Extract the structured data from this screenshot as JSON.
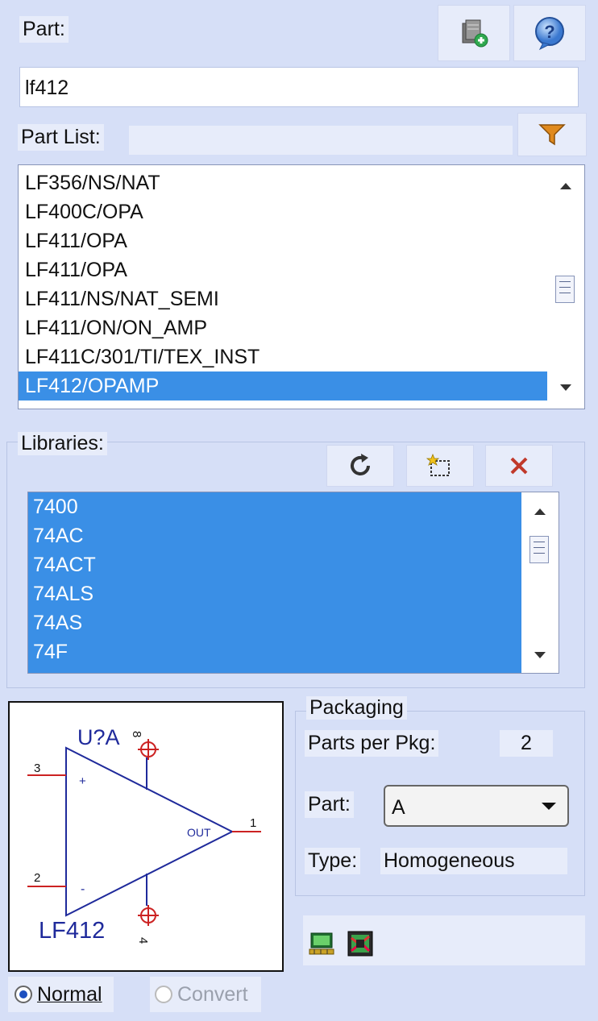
{
  "part": {
    "label": "Part:",
    "value": "lf412"
  },
  "toolbar": {
    "add_part_icon": "add-part-icon",
    "help_icon": "help-icon",
    "filter_icon": "filter-icon"
  },
  "part_list": {
    "label": "Part List:",
    "items": [
      "LF356/NS/NAT",
      "LF400C/OPA",
      "LF411/OPA",
      "LF411/OPA",
      "LF411/NS/NAT_SEMI",
      "LF411/ON/ON_AMP",
      "LF411C/301/TI/TEX_INST",
      "LF412/OPAMP"
    ],
    "selected": "LF412/OPAMP"
  },
  "libraries": {
    "label": "Libraries:",
    "items": [
      "7400",
      "74AC",
      "74ACT",
      "74ALS",
      "74AS",
      "74F"
    ]
  },
  "preview": {
    "refdes": "U?A",
    "value": "LF412",
    "pins": {
      "in_plus": "3",
      "in_minus": "2",
      "out": "1",
      "pin4": "4",
      "pin8": "8",
      "plus": "+",
      "minus": "-",
      "out_label": "OUT"
    }
  },
  "packaging": {
    "title": "Packaging",
    "parts_per_pkg_label": "Parts per Pkg:",
    "parts_per_pkg": "2",
    "part_label": "Part:",
    "part_value": "A",
    "type_label": "Type:",
    "type_value": "Homogeneous"
  },
  "mode": {
    "normal": "Normal",
    "convert": "Convert"
  },
  "colors": {
    "selection": "#3a8fe6",
    "panel": "#d6dff7",
    "delete": "#c0392b",
    "schematic": "#1f2a9b",
    "pin": "#cc2222"
  }
}
